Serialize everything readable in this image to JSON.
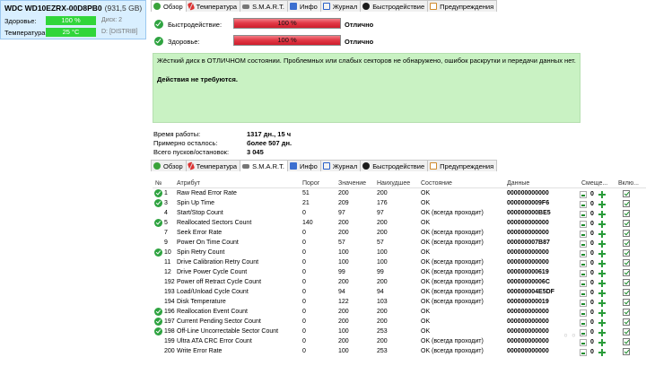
{
  "left_panel": {
    "disk_name": "WDC WD10EZRX-00D8PB0",
    "disk_capacity": "(931,5 GB)",
    "health_label": "Здоровье:",
    "health_value": "100 %",
    "health_side": "Диск: 2",
    "temp_label": "Температура:",
    "temp_value": "25 °C",
    "temp_side": "D: [DISTRIB]",
    "value_color": "#31d63a"
  },
  "tabs": [
    {
      "label": "Обзор",
      "icon": "check-circle-icon"
    },
    {
      "label": "Температура",
      "icon": "thermometer-icon"
    },
    {
      "label": "S.M.A.R.T.",
      "icon": "drive-icon"
    },
    {
      "label": "Инфо",
      "icon": "info-icon"
    },
    {
      "label": "Журнал",
      "icon": "log-icon"
    },
    {
      "label": "Быстродействие",
      "icon": "speedometer-icon"
    },
    {
      "label": "Предупреждения",
      "icon": "warning-icon"
    }
  ],
  "top_status": {
    "perf_label": "Быстродействие:",
    "perf_bar": "100 %",
    "perf_value": "Отлично",
    "health_label": "Здоровье:",
    "health_bar": "100 %",
    "health_value": "Отлично",
    "bar_color": "#e23b48"
  },
  "message": {
    "text": "Жёсткий диск в ОТЛИЧНОМ состоянии. Проблемных или слабых секторов не обнаружено, ошибок раскрутки и передачи данных нет.",
    "action": "Действия не требуются.",
    "bg_color": "#c9f2c3"
  },
  "info": {
    "uptime_label": "Время работы:",
    "uptime_value": "1317 дн., 15 ч",
    "remaining_label": "Примерно осталось:",
    "remaining_value": "более 507 дн.",
    "starts_label": "Всего пусков/остановок:",
    "starts_value": "3 045"
  },
  "table": {
    "headers": {
      "no": "№",
      "attr": "Атрибут",
      "threshold": "Порог",
      "value": "Значение",
      "worst": "Наихудшее",
      "state": "Состояние",
      "data": "Данные",
      "offset": "Смеще...",
      "enabled": "Вклю..."
    },
    "rows": [
      {
        "no": "1",
        "attr": "Raw Read Error Rate",
        "th": "51",
        "val": "200",
        "worst": "200",
        "state": "OK",
        "data": "000000000000",
        "offset": "0",
        "check": true
      },
      {
        "no": "3",
        "attr": "Spin Up Time",
        "th": "21",
        "val": "209",
        "worst": "176",
        "state": "OK",
        "data": "0000000009F6",
        "offset": "0",
        "check": true
      },
      {
        "no": "4",
        "attr": "Start/Stop Count",
        "th": "0",
        "val": "97",
        "worst": "97",
        "state": "OK (всегда проходит)",
        "data": "000000000BE5",
        "offset": "0",
        "check": false
      },
      {
        "no": "5",
        "attr": "Reallocated Sectors Count",
        "th": "140",
        "val": "200",
        "worst": "200",
        "state": "OK",
        "data": "000000000000",
        "offset": "0",
        "check": true
      },
      {
        "no": "7",
        "attr": "Seek Error Rate",
        "th": "0",
        "val": "200",
        "worst": "200",
        "state": "OK (всегда проходит)",
        "data": "000000000000",
        "offset": "0",
        "check": false
      },
      {
        "no": "9",
        "attr": "Power On Time Count",
        "th": "0",
        "val": "57",
        "worst": "57",
        "state": "OK (всегда проходит)",
        "data": "000000007B87",
        "offset": "0",
        "check": false
      },
      {
        "no": "10",
        "attr": "Spin Retry Count",
        "th": "0",
        "val": "100",
        "worst": "100",
        "state": "OK",
        "data": "000000000000",
        "offset": "0",
        "check": true
      },
      {
        "no": "11",
        "attr": "Drive Calibration Retry Count",
        "th": "0",
        "val": "100",
        "worst": "100",
        "state": "OK (всегда проходит)",
        "data": "000000000000",
        "offset": "0",
        "check": false
      },
      {
        "no": "12",
        "attr": "Drive Power Cycle Count",
        "th": "0",
        "val": "99",
        "worst": "99",
        "state": "OK (всегда проходит)",
        "data": "000000000619",
        "offset": "0",
        "check": false
      },
      {
        "no": "192",
        "attr": "Power off Retract Cycle Count",
        "th": "0",
        "val": "200",
        "worst": "200",
        "state": "OK (всегда проходит)",
        "data": "00000000006C",
        "offset": "0",
        "check": false
      },
      {
        "no": "193",
        "attr": "Load/Unload Cycle Count",
        "th": "0",
        "val": "94",
        "worst": "94",
        "state": "OK (всегда проходит)",
        "data": "000000004E5DF",
        "offset": "0",
        "check": false
      },
      {
        "no": "194",
        "attr": "Disk Temperature",
        "th": "0",
        "val": "122",
        "worst": "103",
        "state": "OK (всегда проходит)",
        "data": "000000000019",
        "offset": "0",
        "check": false
      },
      {
        "no": "196",
        "attr": "Reallocation Event Count",
        "th": "0",
        "val": "200",
        "worst": "200",
        "state": "OK",
        "data": "000000000000",
        "offset": "0",
        "check": true
      },
      {
        "no": "197",
        "attr": "Current Pending Sector Count",
        "th": "0",
        "val": "200",
        "worst": "200",
        "state": "OK",
        "data": "000000000000",
        "offset": "0",
        "check": true
      },
      {
        "no": "198",
        "attr": "Off-Line Uncorrectable Sector Count",
        "th": "0",
        "val": "100",
        "worst": "253",
        "state": "OK",
        "data": "000000000000",
        "offset": "0",
        "check": true
      },
      {
        "no": "199",
        "attr": "Ultra ATA CRC Error Count",
        "th": "0",
        "val": "200",
        "worst": "200",
        "state": "OK (всегда проходит)",
        "data": "000000000000",
        "offset": "0",
        "check": false
      },
      {
        "no": "200",
        "attr": "Write Error Rate",
        "th": "0",
        "val": "100",
        "worst": "253",
        "state": "OK (всегда проходит)",
        "data": "000000000000",
        "offset": "0",
        "check": false
      }
    ]
  }
}
